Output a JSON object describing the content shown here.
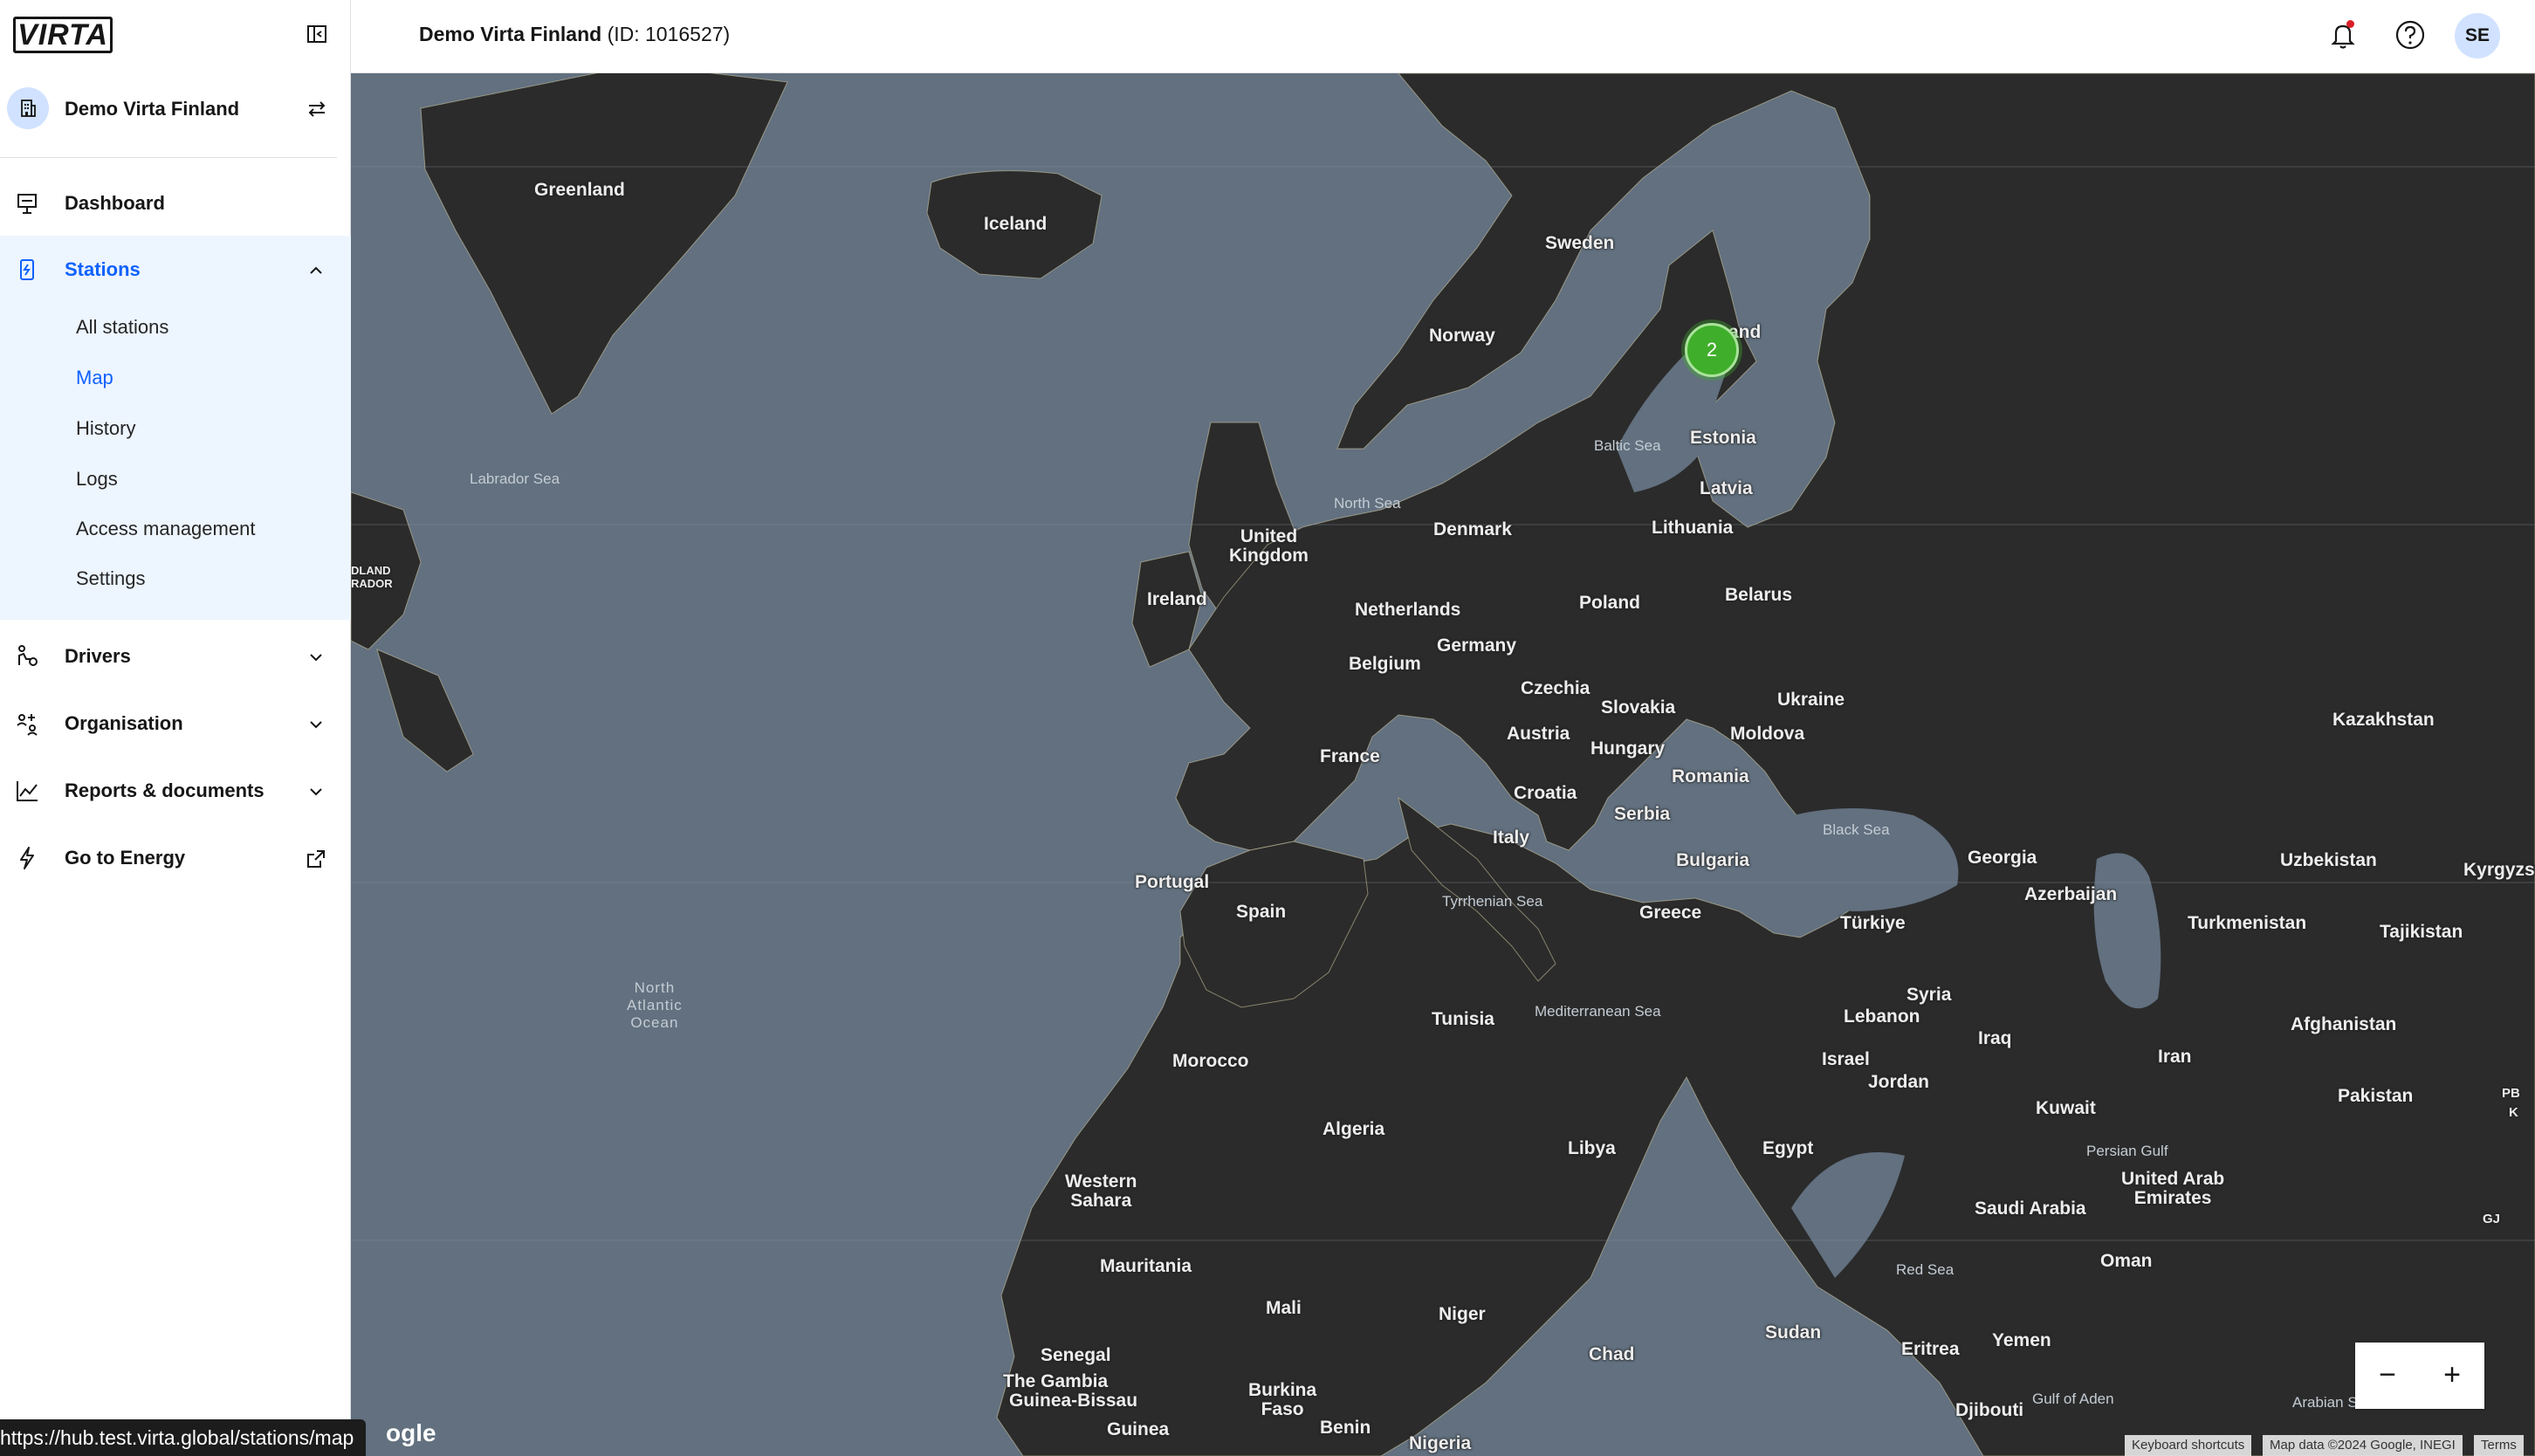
{
  "app": {
    "logo_text": "VIRTA"
  },
  "sidebar": {
    "org_name": "Demo Virta Finland",
    "nav": {
      "dashboard": "Dashboard",
      "stations": "Stations",
      "drivers": "Drivers",
      "organisation": "Organisation",
      "reports": "Reports & documents",
      "energy": "Go to Energy"
    },
    "stations_sub": [
      "All stations",
      "Map",
      "History",
      "Logs",
      "Access management",
      "Settings"
    ],
    "active_sub": "Map"
  },
  "header": {
    "org_name": "Demo Virta Finland",
    "org_id": "(ID: 1016527)",
    "user_initials": "SE"
  },
  "map": {
    "cluster_count": "2",
    "cluster_color": "#3fae2a",
    "zoom_out": "−",
    "zoom_in": "+",
    "attribution_shortcuts": "Keyboard shortcuts",
    "attribution_data": "Map data ©2024 Google, INEGI",
    "attribution_terms": "Terms",
    "google_logo": "ogle",
    "labels": {
      "greenland": "Greenland",
      "iceland": "Iceland",
      "sweden": "Sweden",
      "norway": "Norway",
      "finland": "and",
      "estonia": "Estonia",
      "latvia": "Latvia",
      "lithuania": "Lithuania",
      "denmark": "Denmark",
      "uk": "United\nKingdom",
      "ireland": "Ireland",
      "netherlands": "Netherlands",
      "belgium": "Belgium",
      "germany": "Germany",
      "poland": "Poland",
      "belarus": "Belarus",
      "czechia": "Czechia",
      "slovakia": "Slovakia",
      "ukraine": "Ukraine",
      "austria": "Austria",
      "hungary": "Hungary",
      "moldova": "Moldova",
      "france": "France",
      "croatia": "Croatia",
      "romania": "Romania",
      "serbia": "Serbia",
      "italy": "Italy",
      "bulgaria": "Bulgaria",
      "kazakhstan": "Kazakhstan",
      "georgia": "Georgia",
      "azerbaijan": "Azerbaijan",
      "uzbekistan": "Uzbekistan",
      "kyrgyz": "Kyrgyzst",
      "portugal": "Portugal",
      "spain": "Spain",
      "greece": "Greece",
      "turkiye": "Türkiye",
      "turkmenistan": "Turkmenistan",
      "tajikistan": "Tajikistan",
      "tunisia": "Tunisia",
      "syria": "Syria",
      "lebanon": "Lebanon",
      "iraq": "Iraq",
      "afghanistan": "Afghanistan",
      "israel": "Israel",
      "iran": "Iran",
      "morocco": "Morocco",
      "jordan": "Jordan",
      "kuwait": "Kuwait",
      "pakistan": "Pakistan",
      "algeria": "Algeria",
      "libya": "Libya",
      "egypt": "Egypt",
      "uae": "United Arab\nEmirates",
      "w_sahara": "Western\nSahara",
      "saudi": "Saudi Arabia",
      "oman": "Oman",
      "mauritania": "Mauritania",
      "mali": "Mali",
      "niger": "Niger",
      "chad": "Chad",
      "sudan": "Sudan",
      "eritrea": "Eritrea",
      "yemen": "Yemen",
      "senegal": "Senegal",
      "gambia": "The Gambia",
      "guinea_bissau": "Guinea-Bissau",
      "burkina": "Burkina\nFaso",
      "benin": "Benin",
      "guinea": "Guinea",
      "nigeria": "Nigeria",
      "djibouti": "Djibouti",
      "labrador_frag": "DLAND\nRADOR",
      "pb": "PB",
      "k": "K",
      "gj": "GJ"
    },
    "seas": {
      "labrador": "Labrador Sea",
      "north_sea": "North Sea",
      "baltic": "Baltic Sea",
      "atlantic": "North\nAtlantic\nOcean",
      "black": "Black Sea",
      "tyrrhenian": "Tyrrhenian Sea",
      "mediterranean": "Mediterranean Sea",
      "persian": "Persian Gulf",
      "red": "Red Sea",
      "aden": "Gulf of Aden",
      "arabian": "Arabian S"
    }
  },
  "status_bar": {
    "url": "https://hub.test.virta.global/stations/map"
  }
}
